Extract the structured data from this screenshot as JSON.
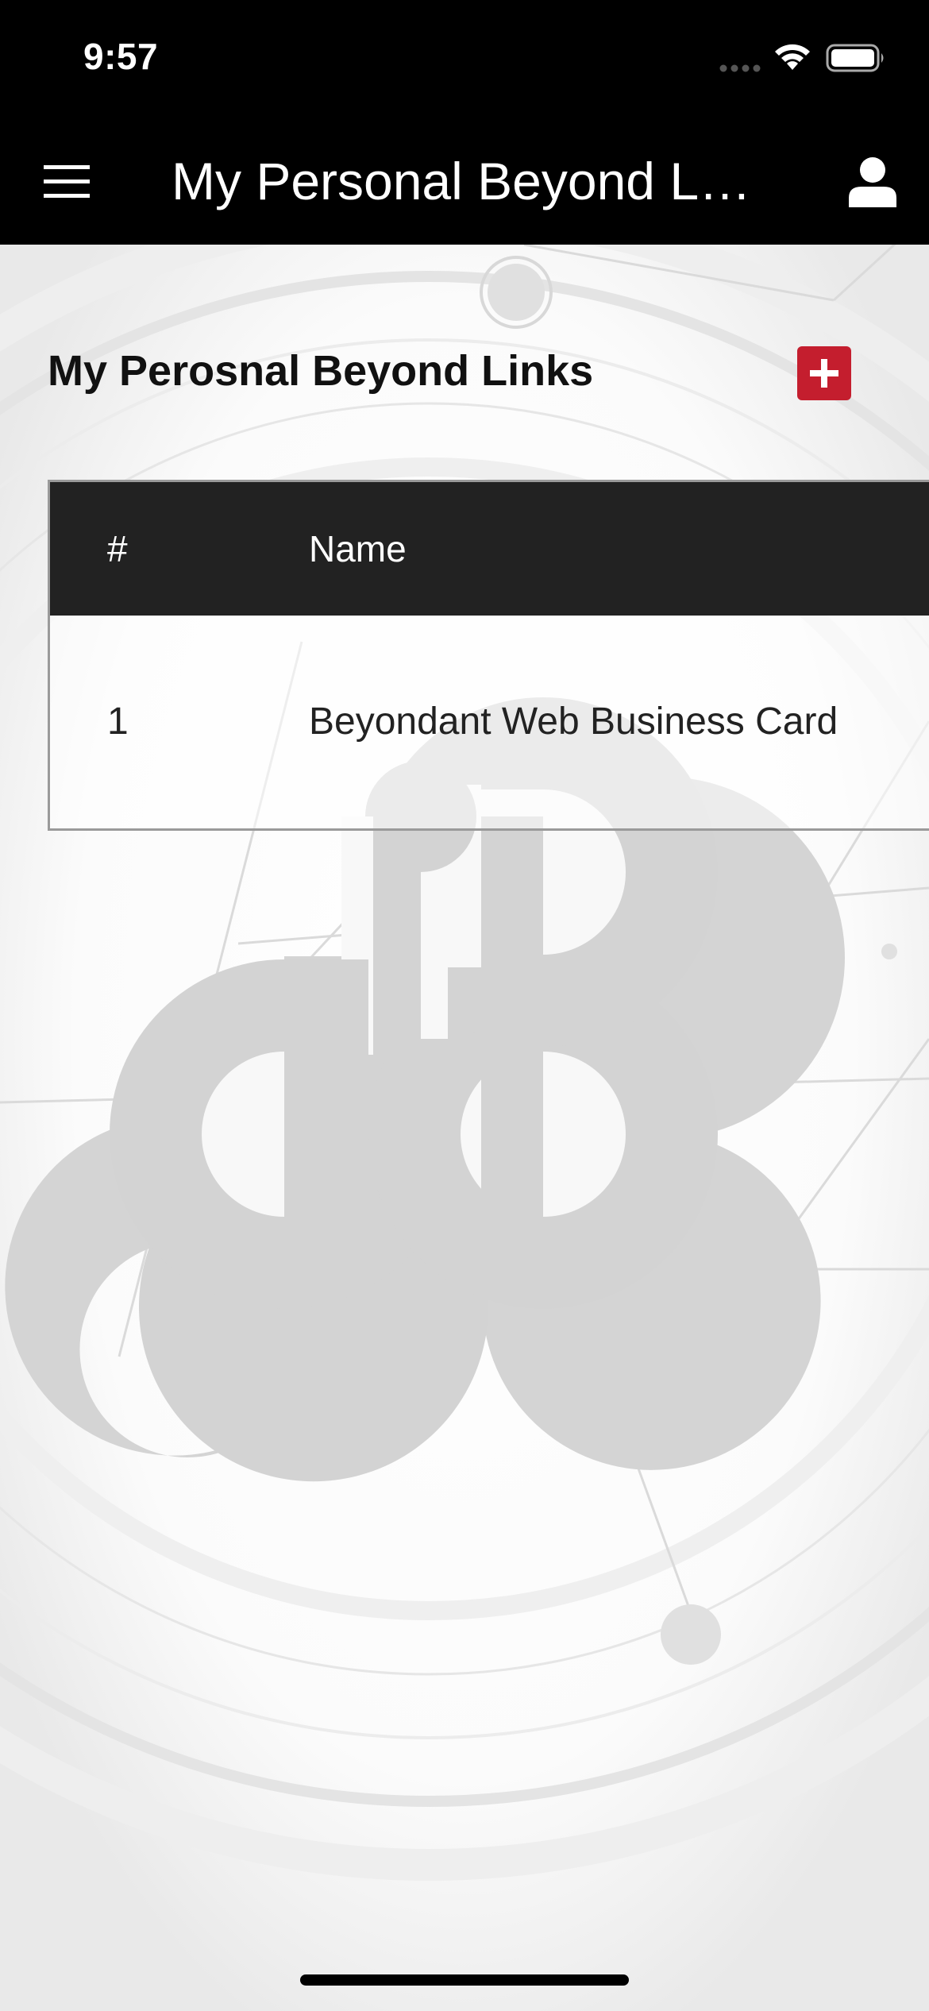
{
  "status_bar": {
    "time": "9:57",
    "icons": [
      "cellular-signal-icon",
      "wifi-icon",
      "battery-icon"
    ]
  },
  "header": {
    "title": "My Personal Beyond Links",
    "menu_icon": "hamburger-menu-icon",
    "profile_icon": "user-profile-icon"
  },
  "main": {
    "section_title": "My Perosnal Beyond Links",
    "add_icon": "plus-icon",
    "table": {
      "columns": [
        "#",
        "Name"
      ],
      "rows": [
        {
          "index": "1",
          "name": "Beyondant Web Business Card"
        }
      ]
    },
    "background_logo": "beyondant-logo"
  },
  "colors": {
    "header_bg": "#000000",
    "table_header_bg": "#222222",
    "accent_red": "#c41e2e"
  }
}
